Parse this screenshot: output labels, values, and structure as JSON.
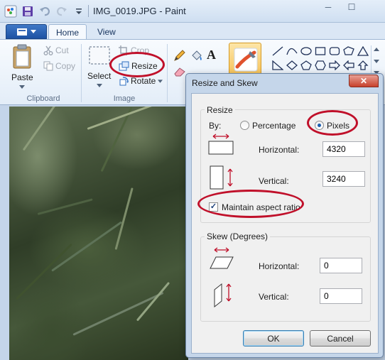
{
  "window": {
    "title": "IMG_0019.JPG - Paint"
  },
  "ribbon": {
    "tabs": [
      {
        "label": "Home"
      },
      {
        "label": "View"
      }
    ],
    "clipboard": {
      "paste": "Paste",
      "cut": "Cut",
      "copy": "Copy",
      "group_label": "Clipboard"
    },
    "image": {
      "select": "Select",
      "crop": "Crop",
      "resize": "Resize",
      "rotate": "Rotate",
      "group_label": "Image"
    }
  },
  "dialog": {
    "title": "Resize and Skew",
    "resize": {
      "legend": "Resize",
      "by_label": "By:",
      "percentage_label": "Percentage",
      "pixels_label": "Pixels",
      "selected_unit": "Pixels",
      "horizontal_label": "Horizontal:",
      "horizontal_value": "4320",
      "vertical_label": "Vertical:",
      "vertical_value": "3240",
      "maintain_label": "Maintain aspect ratio",
      "maintain_checked": true
    },
    "skew": {
      "legend": "Skew (Degrees)",
      "horizontal_label": "Horizontal:",
      "horizontal_value": "0",
      "vertical_label": "Vertical:",
      "vertical_value": "0"
    },
    "ok_label": "OK",
    "cancel_label": "Cancel"
  },
  "colors": {
    "annotation": "#c0102a",
    "accent": "#1c5fb0"
  }
}
